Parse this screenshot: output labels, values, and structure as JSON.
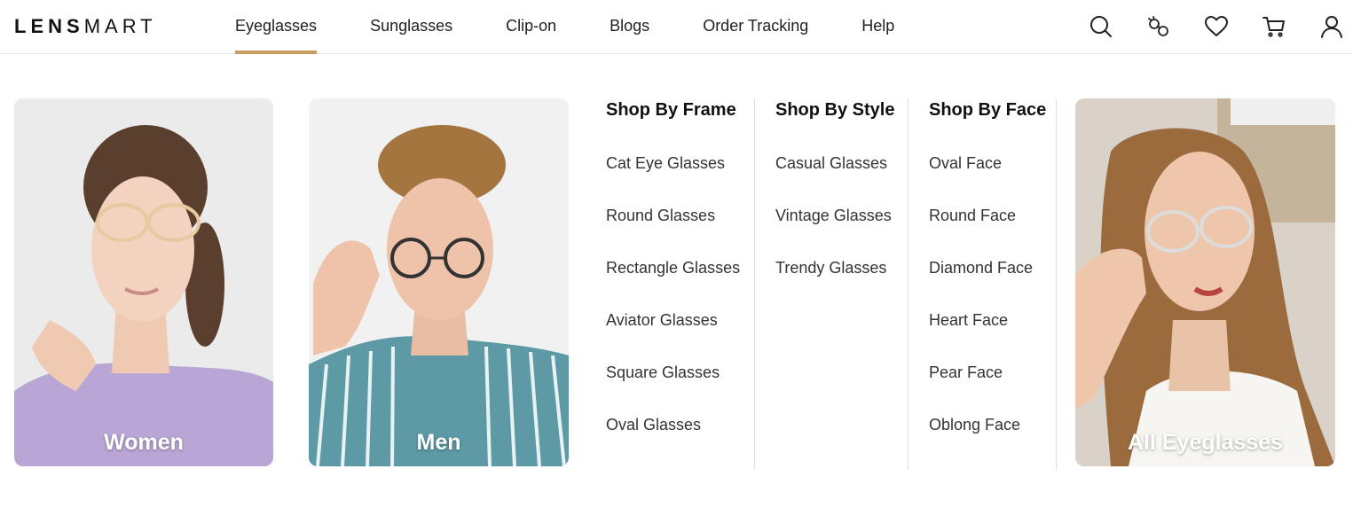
{
  "brand": {
    "logo_bold": "LENS",
    "logo_light": "MART"
  },
  "nav": [
    {
      "label": "Eyeglasses",
      "active": true
    },
    {
      "label": "Sunglasses"
    },
    {
      "label": "Clip-on"
    },
    {
      "label": "Blogs"
    },
    {
      "label": "Order Tracking"
    },
    {
      "label": "Help"
    }
  ],
  "header_icons": [
    "search-icon",
    "try-on-icon",
    "wishlist-heart-icon",
    "cart-icon",
    "account-icon"
  ],
  "cards": {
    "women": "Women",
    "men": "Men",
    "all": "All Eyeglasses"
  },
  "columns": {
    "frame": {
      "title": "Shop By Frame",
      "items": [
        "Cat Eye Glasses",
        "Round Glasses",
        "Rectangle Glasses",
        "Aviator Glasses",
        "Square Glasses",
        "Oval Glasses"
      ]
    },
    "style": {
      "title": "Shop By Style",
      "items": [
        "Casual Glasses",
        "Vintage Glasses",
        "Trendy Glasses"
      ]
    },
    "face": {
      "title": "Shop By Face",
      "items": [
        "Oval Face",
        "Round Face",
        "Diamond Face",
        "Heart Face",
        "Pear Face",
        "Oblong Face"
      ]
    }
  },
  "colors": {
    "accent": "#c99b63",
    "women_bg": "#b9a6d6",
    "men_shirt": "#5d9aa6"
  }
}
